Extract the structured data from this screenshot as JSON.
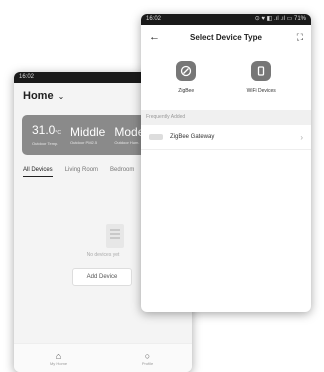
{
  "back_phone": {
    "status_time": "16:02",
    "status_icons": "⊙ ♥ ◧",
    "home_title": "Home",
    "weather": [
      {
        "value": "31.0",
        "unit": "°C",
        "caption": "Outdoor Temp."
      },
      {
        "value": "Middle",
        "caption": "Outdoor PM2.5"
      },
      {
        "value": "Modera",
        "caption": "Outdoor Hum."
      }
    ],
    "tabs": [
      "All Devices",
      "Living Room",
      "Bedroom"
    ],
    "empty_text": "No devices yet",
    "add_device_label": "Add Device",
    "nav": [
      {
        "label": "My Home",
        "icon": "home-icon"
      },
      {
        "label": "Profile",
        "icon": "profile-icon"
      }
    ]
  },
  "front_phone": {
    "status_time": "16:02",
    "status_icons": "⊙ ♥ ◧ .ıl .ıl ▭ 71%",
    "title": "Select Device Type",
    "types": [
      {
        "label": "ZigBee",
        "icon": "zigbee-icon"
      },
      {
        "label": "WiFi Devices",
        "icon": "wifi-device-icon"
      }
    ],
    "section_label": "Frequently Added",
    "frequent": [
      {
        "label": "ZigBee Gateway",
        "icon": "gateway-icon"
      }
    ]
  }
}
